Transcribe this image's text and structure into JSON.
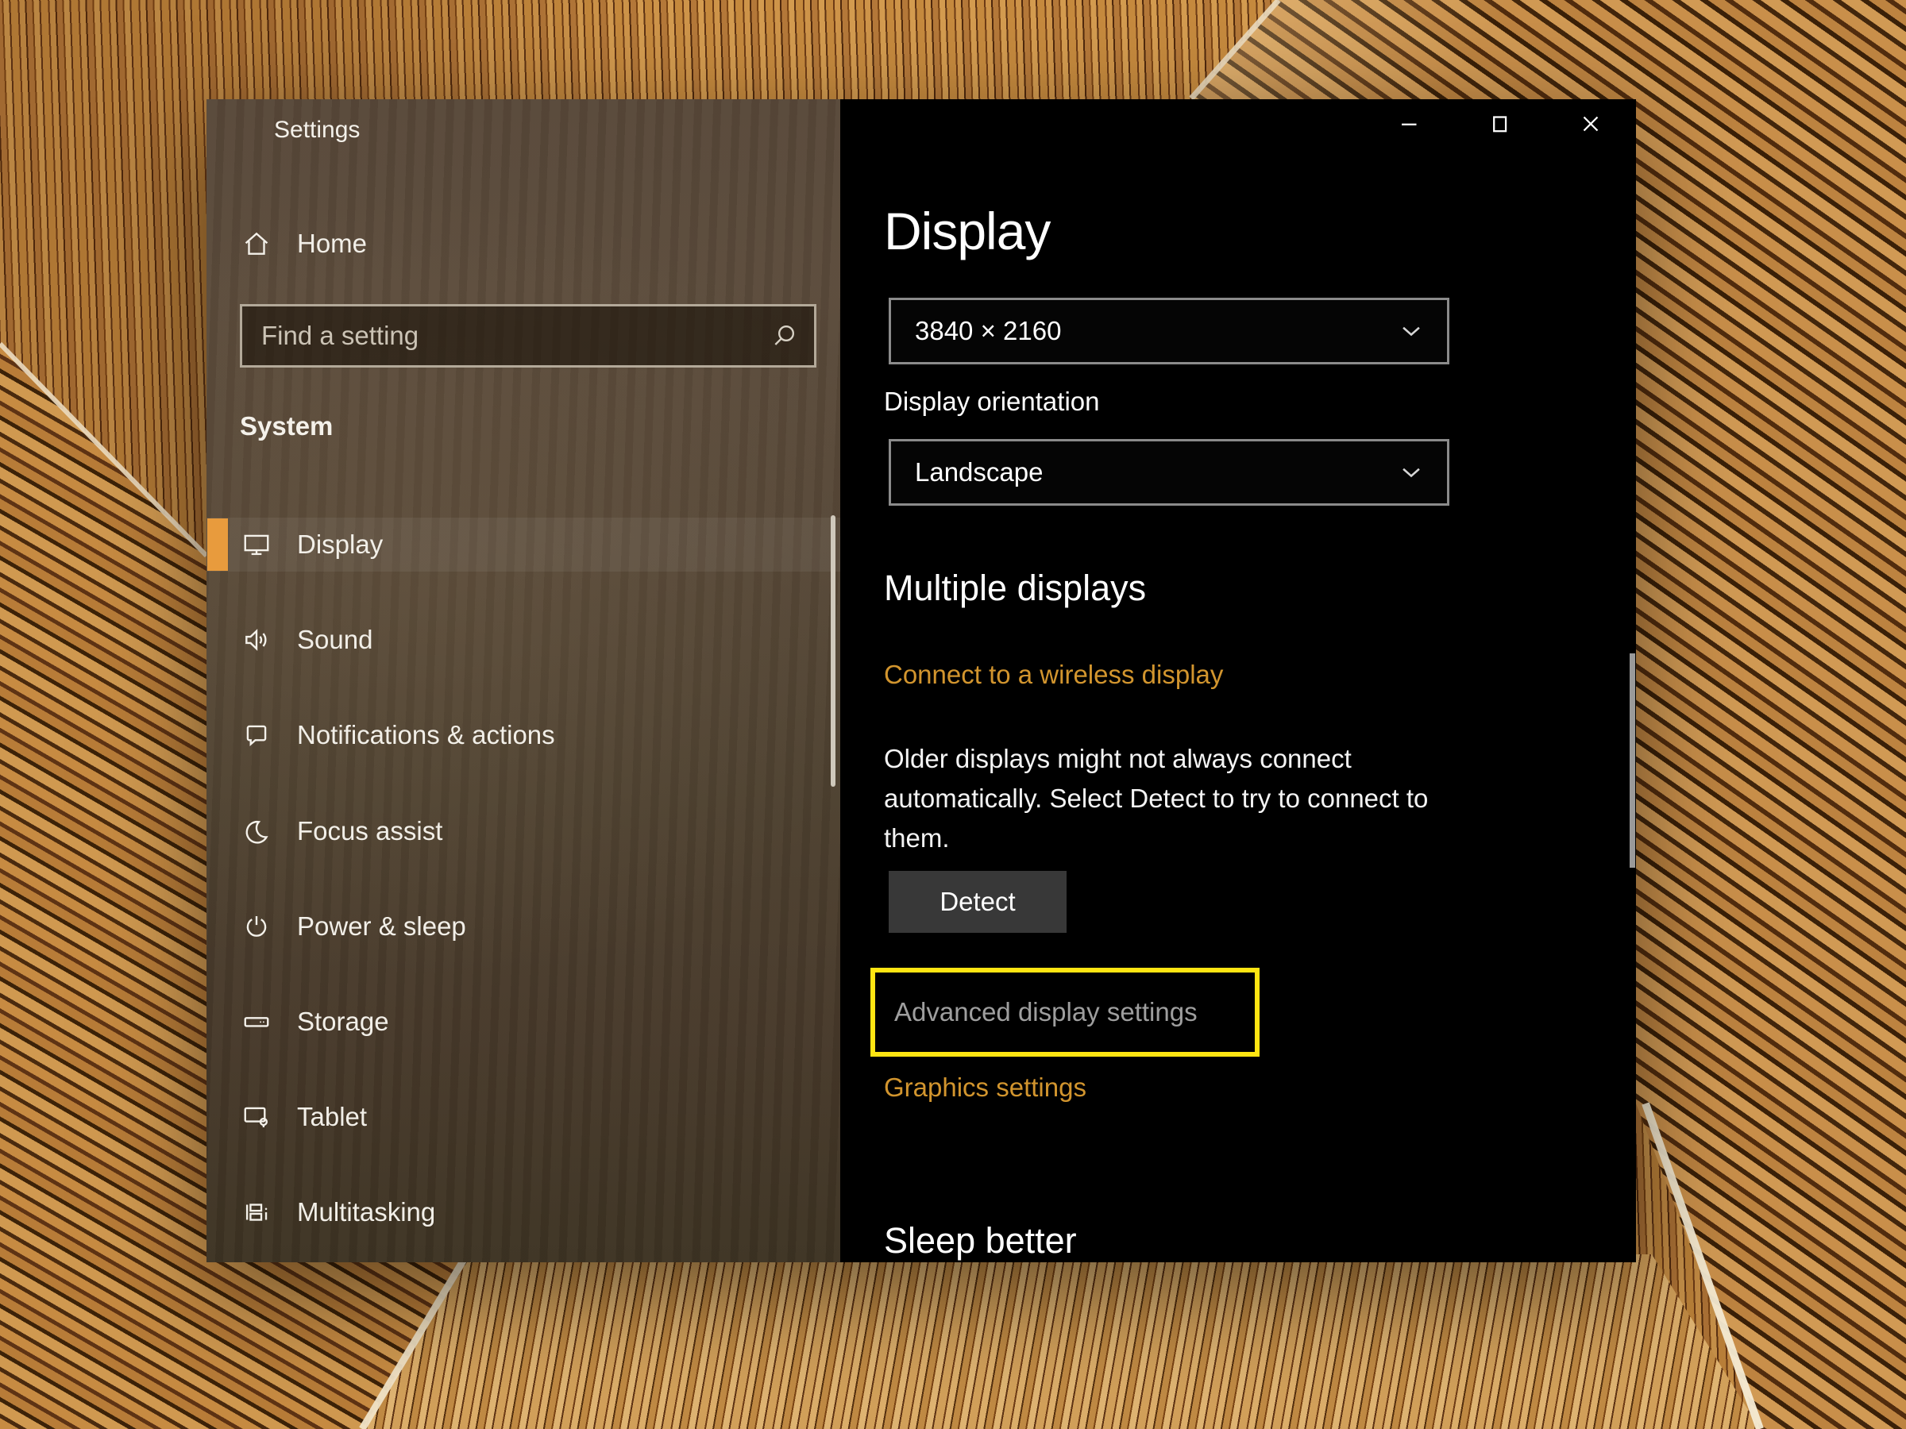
{
  "window": {
    "title": "Settings",
    "controls": {
      "minimize_icon": "minimize-icon",
      "maximize_icon": "maximize-icon",
      "close_icon": "close-icon"
    }
  },
  "sidebar": {
    "home_label": "Home",
    "search_placeholder": "Find a setting",
    "section_label": "System",
    "items": [
      {
        "label": "Display",
        "icon": "display-icon",
        "active": true
      },
      {
        "label": "Sound",
        "icon": "sound-icon",
        "active": false
      },
      {
        "label": "Notifications & actions",
        "icon": "notifications-icon",
        "active": false
      },
      {
        "label": "Focus assist",
        "icon": "focus-assist-icon",
        "active": false
      },
      {
        "label": "Power & sleep",
        "icon": "power-icon",
        "active": false
      },
      {
        "label": "Storage",
        "icon": "storage-icon",
        "active": false
      },
      {
        "label": "Tablet",
        "icon": "tablet-icon",
        "active": false
      },
      {
        "label": "Multitasking",
        "icon": "multitasking-icon",
        "active": false
      }
    ]
  },
  "content": {
    "page_title": "Display",
    "resolution_dropdown": {
      "value": "3840 × 2160"
    },
    "orientation_label": "Display orientation",
    "orientation_dropdown": {
      "value": "Landscape"
    },
    "multiple_displays_heading": "Multiple displays",
    "wireless_link": "Connect to a wireless display",
    "detect_description_lines": [
      "Older displays might not always connect",
      "automatically. Select Detect to try to connect to",
      "them."
    ],
    "detect_button": "Detect",
    "advanced_link": "Advanced display settings",
    "graphics_link": "Graphics settings",
    "next_section_heading": "Sleep better"
  },
  "colors": {
    "accent_orange": "#e89b3d",
    "link_orange": "#d2952e",
    "highlight_yellow": "#ffe512",
    "pane_background": "#000000",
    "sidebar_brown": "#4d402f"
  }
}
